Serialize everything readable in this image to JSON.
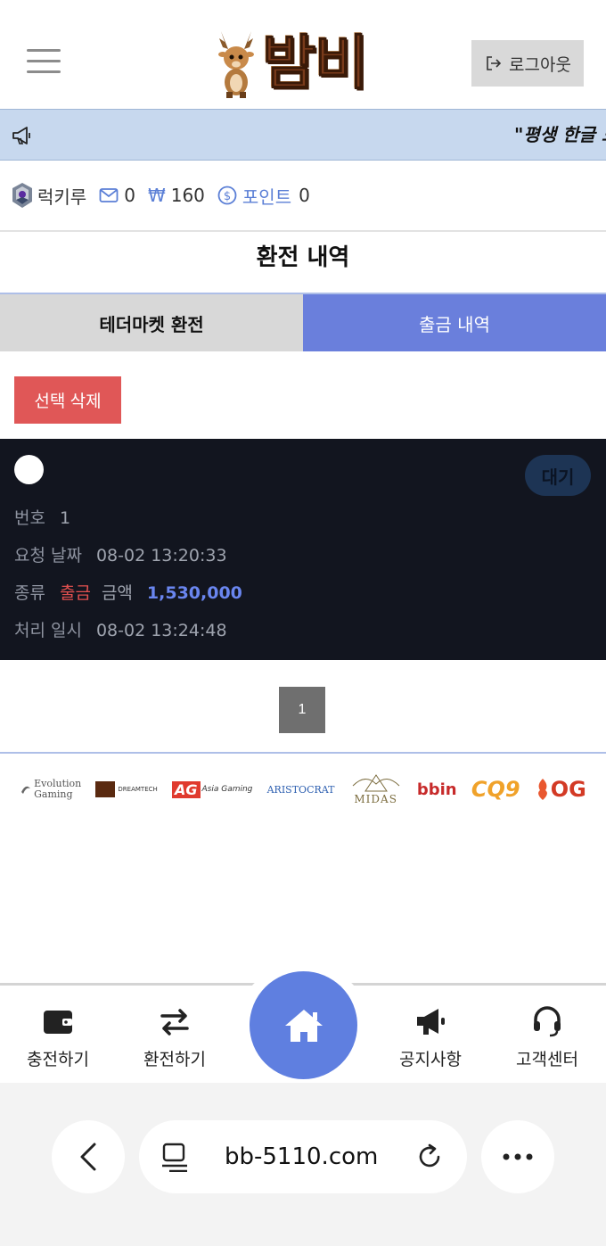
{
  "header": {
    "logo_text": "밤비",
    "logout_label": "로그아웃"
  },
  "notice": {
    "text": "\"평생 한글 도"
  },
  "user": {
    "name": "럭키루",
    "messages": "0",
    "currency_symbol": "₩",
    "balance": "160",
    "points_label": "포인트",
    "points": "0"
  },
  "page": {
    "title": "환전 내역"
  },
  "tabs": [
    {
      "label": "테더마켓 환전",
      "active": false
    },
    {
      "label": "출금 내역",
      "active": true
    }
  ],
  "actions": {
    "delete_selected": "선택 삭제"
  },
  "record": {
    "status": "대기",
    "number_label": "번호",
    "number": "1",
    "request_date_label": "요청 날짜",
    "request_date": "08-02 13:20:33",
    "type_label": "종류",
    "type": "출금",
    "amount_label": "금액",
    "amount": "1,530,000",
    "processed_label": "처리 일시",
    "processed_date": "08-02 13:24:48"
  },
  "pagination": {
    "current": "1"
  },
  "providers": {
    "evolution_1": "Evolution",
    "evolution_2": "Gaming",
    "dreamtech": "DREAMTECH",
    "ag_mark": "AG",
    "ag_text": "Asia Gaming",
    "aristocrat": "ARISTOCRAT",
    "midas": "MIDAS",
    "bbin": "bbin",
    "cq9": "CQ9",
    "og": "OG"
  },
  "bottom_nav": [
    {
      "label": "충전하기",
      "icon": "wallet-icon"
    },
    {
      "label": "환전하기",
      "icon": "exchange-icon"
    },
    {
      "label": "",
      "icon": "home-icon"
    },
    {
      "label": "공지사항",
      "icon": "megaphone-icon"
    },
    {
      "label": "고객센터",
      "icon": "headset-icon"
    }
  ],
  "browser": {
    "url": "bb-5110.com"
  },
  "colors": {
    "accent": "#6a7fdc",
    "home_button": "#5f7fe0",
    "danger": "#e05757",
    "notice_bg": "#c7d8ee",
    "record_bg": "#12151f"
  }
}
